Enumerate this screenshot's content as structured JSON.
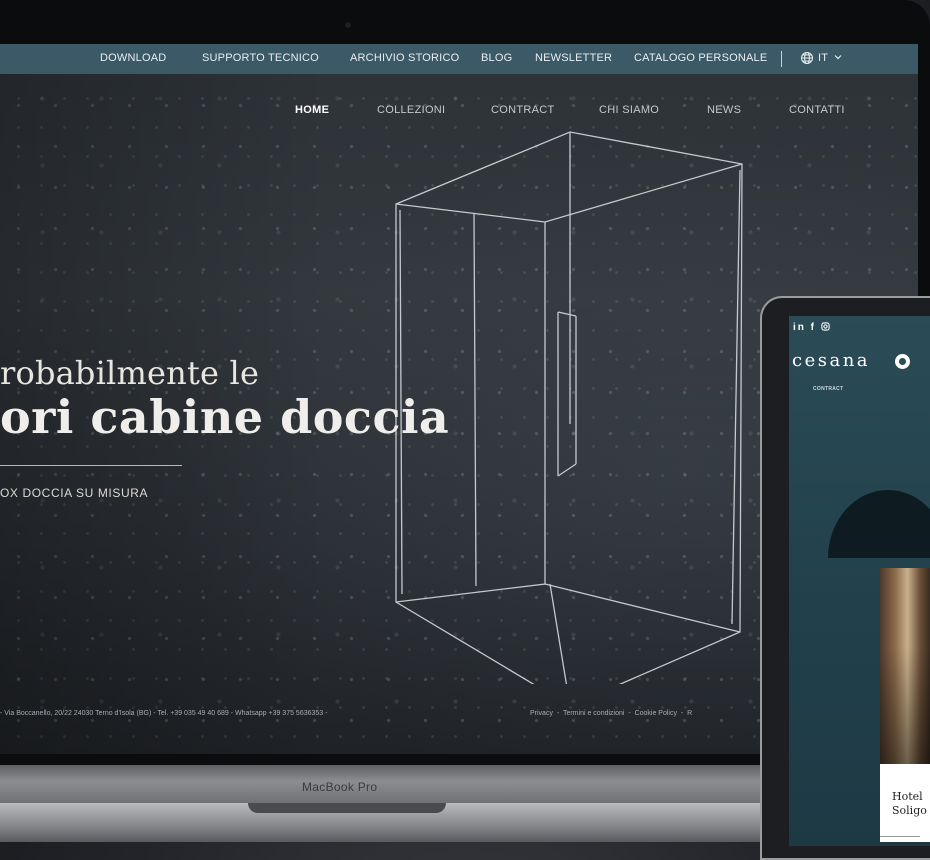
{
  "laptop": {
    "model_label": "MacBook Pro",
    "topbar": {
      "items": [
        "DOWNLOAD",
        "SUPPORTO TECNICO",
        "ARCHIVIO STORICO",
        "BLOG",
        "NEWSLETTER",
        "CATALOGO PERSONALE"
      ],
      "language": "IT"
    },
    "nav": [
      "HOME",
      "COLLEZIONI",
      "CONTRACT",
      "CHI SIAMO",
      "NEWS",
      "CONTATTI"
    ],
    "hero": {
      "line1": "robabilmente le",
      "line2": "ori cabine doccia",
      "subtitle": "OX DOCCIA SU MISURA"
    },
    "footer": {
      "address": "- Via Boccanello, 20/22 24030 Terno d'Isola (BG) - Tel. +39 035 49 40 689 - Whatsapp +39 375 5636353 -",
      "links": [
        "Privacy",
        "Termini e condizioni",
        "Cookie Policy",
        "R"
      ]
    }
  },
  "tablet": {
    "social_icons": [
      "linkedin-icon",
      "facebook-icon",
      "instagram-icon"
    ],
    "logo": "cesana",
    "nav_label": "CONTRACT",
    "card_title_line1": "Hotel",
    "card_title_line2": "Soligo"
  },
  "colors": {
    "topbar": "#3b5966",
    "tablet_bg": "#2b4b57",
    "hero_text": "#efeeeb"
  }
}
